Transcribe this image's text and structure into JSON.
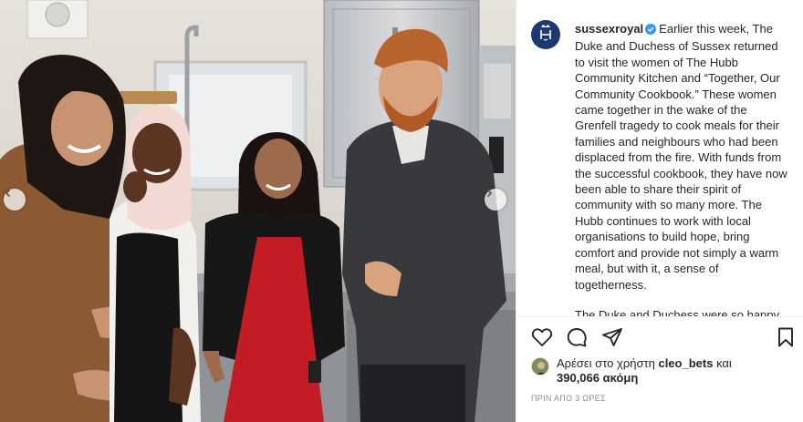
{
  "post": {
    "username": "sussexroyal",
    "caption_p1": "Earlier this week, The Duke and Duchess of Sussex returned to visit the women of The Hubb Community Kitchen and “Together, Our Community Cookbook.” These women came together in the wake of the Grenfell tragedy to cook meals for their families and neighbours who had been displaced from the fire. With funds from the successful cookbook, they have now been able to share their spirit of community with so many more. The Hubb continues to work with local organisations to build hope, bring comfort and provide not simply a warm meal, but with it, a sense of togetherness.",
    "caption_p2": "The Duke and Duchess were so happy to reconnect with these women and lo"
  },
  "likes": {
    "prefix": "Αρέσει στο χρήστη",
    "user": "cleo_bets",
    "conjunction": "και",
    "count": "390,066",
    "suffix": "ακόμη"
  },
  "timestamp": "ΠΡΙΝ ΑΠΟ 3 ΩΡΕΣ",
  "icons": {
    "avatar": "royal-monogram-icon",
    "verified": "verified-badge-icon",
    "like": "heart-icon",
    "comment": "comment-icon",
    "share": "send-icon",
    "save": "bookmark-icon",
    "prev": "chevron-left-icon",
    "next": "chevron-right-icon"
  },
  "colors": {
    "verified": "#3897f0",
    "avatar_bg": "#1d3a70",
    "text": "#262626",
    "muted": "#8e8e8e"
  }
}
